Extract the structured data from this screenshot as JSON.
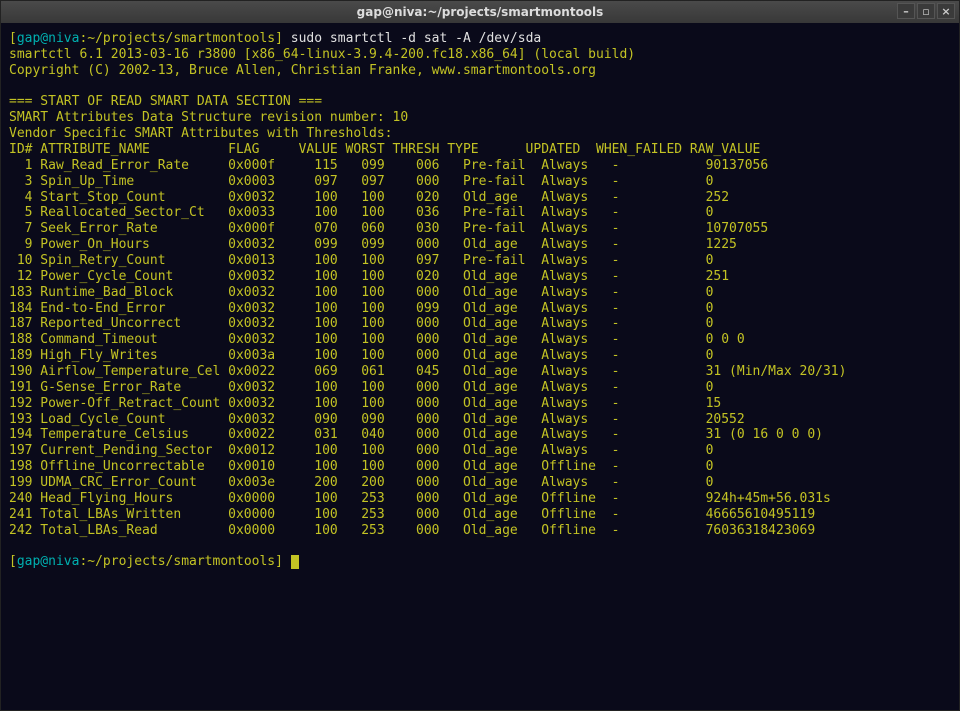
{
  "window": {
    "title": "gap@niva:~/projects/smartmontools"
  },
  "prompt": {
    "user": "gap@niva",
    "path": "~/projects/smartmontools",
    "command": "sudo smartctl -d sat -A /dev/sda"
  },
  "output": {
    "version_line": "smartctl 6.1 2013-03-16 r3800 [x86_64-linux-3.9.4-200.fc18.x86_64] (local build)",
    "copyright_line": "Copyright (C) 2002-13, Bruce Allen, Christian Franke, www.smartmontools.org",
    "section_header": "=== START OF READ SMART DATA SECTION ===",
    "revision_line": "SMART Attributes Data Structure revision number: 10",
    "vendor_line": "Vendor Specific SMART Attributes with Thresholds:"
  },
  "table": {
    "headers": {
      "id": "ID#",
      "attribute_name": "ATTRIBUTE_NAME",
      "flag": "FLAG",
      "value": "VALUE",
      "worst": "WORST",
      "thresh": "THRESH",
      "type": "TYPE",
      "updated": "UPDATED",
      "when_failed": "WHEN_FAILED",
      "raw_value": "RAW_VALUE"
    },
    "rows": [
      {
        "id": "1",
        "name": "Raw_Read_Error_Rate",
        "flag": "0x000f",
        "value": "115",
        "worst": "099",
        "thresh": "006",
        "type": "Pre-fail",
        "updated": "Always",
        "when_failed": "-",
        "raw": "90137056"
      },
      {
        "id": "3",
        "name": "Spin_Up_Time",
        "flag": "0x0003",
        "value": "097",
        "worst": "097",
        "thresh": "000",
        "type": "Pre-fail",
        "updated": "Always",
        "when_failed": "-",
        "raw": "0"
      },
      {
        "id": "4",
        "name": "Start_Stop_Count",
        "flag": "0x0032",
        "value": "100",
        "worst": "100",
        "thresh": "020",
        "type": "Old_age",
        "updated": "Always",
        "when_failed": "-",
        "raw": "252"
      },
      {
        "id": "5",
        "name": "Reallocated_Sector_Ct",
        "flag": "0x0033",
        "value": "100",
        "worst": "100",
        "thresh": "036",
        "type": "Pre-fail",
        "updated": "Always",
        "when_failed": "-",
        "raw": "0"
      },
      {
        "id": "7",
        "name": "Seek_Error_Rate",
        "flag": "0x000f",
        "value": "070",
        "worst": "060",
        "thresh": "030",
        "type": "Pre-fail",
        "updated": "Always",
        "when_failed": "-",
        "raw": "10707055"
      },
      {
        "id": "9",
        "name": "Power_On_Hours",
        "flag": "0x0032",
        "value": "099",
        "worst": "099",
        "thresh": "000",
        "type": "Old_age",
        "updated": "Always",
        "when_failed": "-",
        "raw": "1225"
      },
      {
        "id": "10",
        "name": "Spin_Retry_Count",
        "flag": "0x0013",
        "value": "100",
        "worst": "100",
        "thresh": "097",
        "type": "Pre-fail",
        "updated": "Always",
        "when_failed": "-",
        "raw": "0"
      },
      {
        "id": "12",
        "name": "Power_Cycle_Count",
        "flag": "0x0032",
        "value": "100",
        "worst": "100",
        "thresh": "020",
        "type": "Old_age",
        "updated": "Always",
        "when_failed": "-",
        "raw": "251"
      },
      {
        "id": "183",
        "name": "Runtime_Bad_Block",
        "flag": "0x0032",
        "value": "100",
        "worst": "100",
        "thresh": "000",
        "type": "Old_age",
        "updated": "Always",
        "when_failed": "-",
        "raw": "0"
      },
      {
        "id": "184",
        "name": "End-to-End_Error",
        "flag": "0x0032",
        "value": "100",
        "worst": "100",
        "thresh": "099",
        "type": "Old_age",
        "updated": "Always",
        "when_failed": "-",
        "raw": "0"
      },
      {
        "id": "187",
        "name": "Reported_Uncorrect",
        "flag": "0x0032",
        "value": "100",
        "worst": "100",
        "thresh": "000",
        "type": "Old_age",
        "updated": "Always",
        "when_failed": "-",
        "raw": "0"
      },
      {
        "id": "188",
        "name": "Command_Timeout",
        "flag": "0x0032",
        "value": "100",
        "worst": "100",
        "thresh": "000",
        "type": "Old_age",
        "updated": "Always",
        "when_failed": "-",
        "raw": "0 0 0"
      },
      {
        "id": "189",
        "name": "High_Fly_Writes",
        "flag": "0x003a",
        "value": "100",
        "worst": "100",
        "thresh": "000",
        "type": "Old_age",
        "updated": "Always",
        "when_failed": "-",
        "raw": "0"
      },
      {
        "id": "190",
        "name": "Airflow_Temperature_Cel",
        "flag": "0x0022",
        "value": "069",
        "worst": "061",
        "thresh": "045",
        "type": "Old_age",
        "updated": "Always",
        "when_failed": "-",
        "raw": "31 (Min/Max 20/31)"
      },
      {
        "id": "191",
        "name": "G-Sense_Error_Rate",
        "flag": "0x0032",
        "value": "100",
        "worst": "100",
        "thresh": "000",
        "type": "Old_age",
        "updated": "Always",
        "when_failed": "-",
        "raw": "0"
      },
      {
        "id": "192",
        "name": "Power-Off_Retract_Count",
        "flag": "0x0032",
        "value": "100",
        "worst": "100",
        "thresh": "000",
        "type": "Old_age",
        "updated": "Always",
        "when_failed": "-",
        "raw": "15"
      },
      {
        "id": "193",
        "name": "Load_Cycle_Count",
        "flag": "0x0032",
        "value": "090",
        "worst": "090",
        "thresh": "000",
        "type": "Old_age",
        "updated": "Always",
        "when_failed": "-",
        "raw": "20552"
      },
      {
        "id": "194",
        "name": "Temperature_Celsius",
        "flag": "0x0022",
        "value": "031",
        "worst": "040",
        "thresh": "000",
        "type": "Old_age",
        "updated": "Always",
        "when_failed": "-",
        "raw": "31 (0 16 0 0 0)"
      },
      {
        "id": "197",
        "name": "Current_Pending_Sector",
        "flag": "0x0012",
        "value": "100",
        "worst": "100",
        "thresh": "000",
        "type": "Old_age",
        "updated": "Always",
        "when_failed": "-",
        "raw": "0"
      },
      {
        "id": "198",
        "name": "Offline_Uncorrectable",
        "flag": "0x0010",
        "value": "100",
        "worst": "100",
        "thresh": "000",
        "type": "Old_age",
        "updated": "Offline",
        "when_failed": "-",
        "raw": "0"
      },
      {
        "id": "199",
        "name": "UDMA_CRC_Error_Count",
        "flag": "0x003e",
        "value": "200",
        "worst": "200",
        "thresh": "000",
        "type": "Old_age",
        "updated": "Always",
        "when_failed": "-",
        "raw": "0"
      },
      {
        "id": "240",
        "name": "Head_Flying_Hours",
        "flag": "0x0000",
        "value": "100",
        "worst": "253",
        "thresh": "000",
        "type": "Old_age",
        "updated": "Offline",
        "when_failed": "-",
        "raw": "924h+45m+56.031s"
      },
      {
        "id": "241",
        "name": "Total_LBAs_Written",
        "flag": "0x0000",
        "value": "100",
        "worst": "253",
        "thresh": "000",
        "type": "Old_age",
        "updated": "Offline",
        "when_failed": "-",
        "raw": "46665610495119"
      },
      {
        "id": "242",
        "name": "Total_LBAs_Read",
        "flag": "0x0000",
        "value": "100",
        "worst": "253",
        "thresh": "000",
        "type": "Old_age",
        "updated": "Offline",
        "when_failed": "-",
        "raw": "76036318423069"
      }
    ]
  }
}
